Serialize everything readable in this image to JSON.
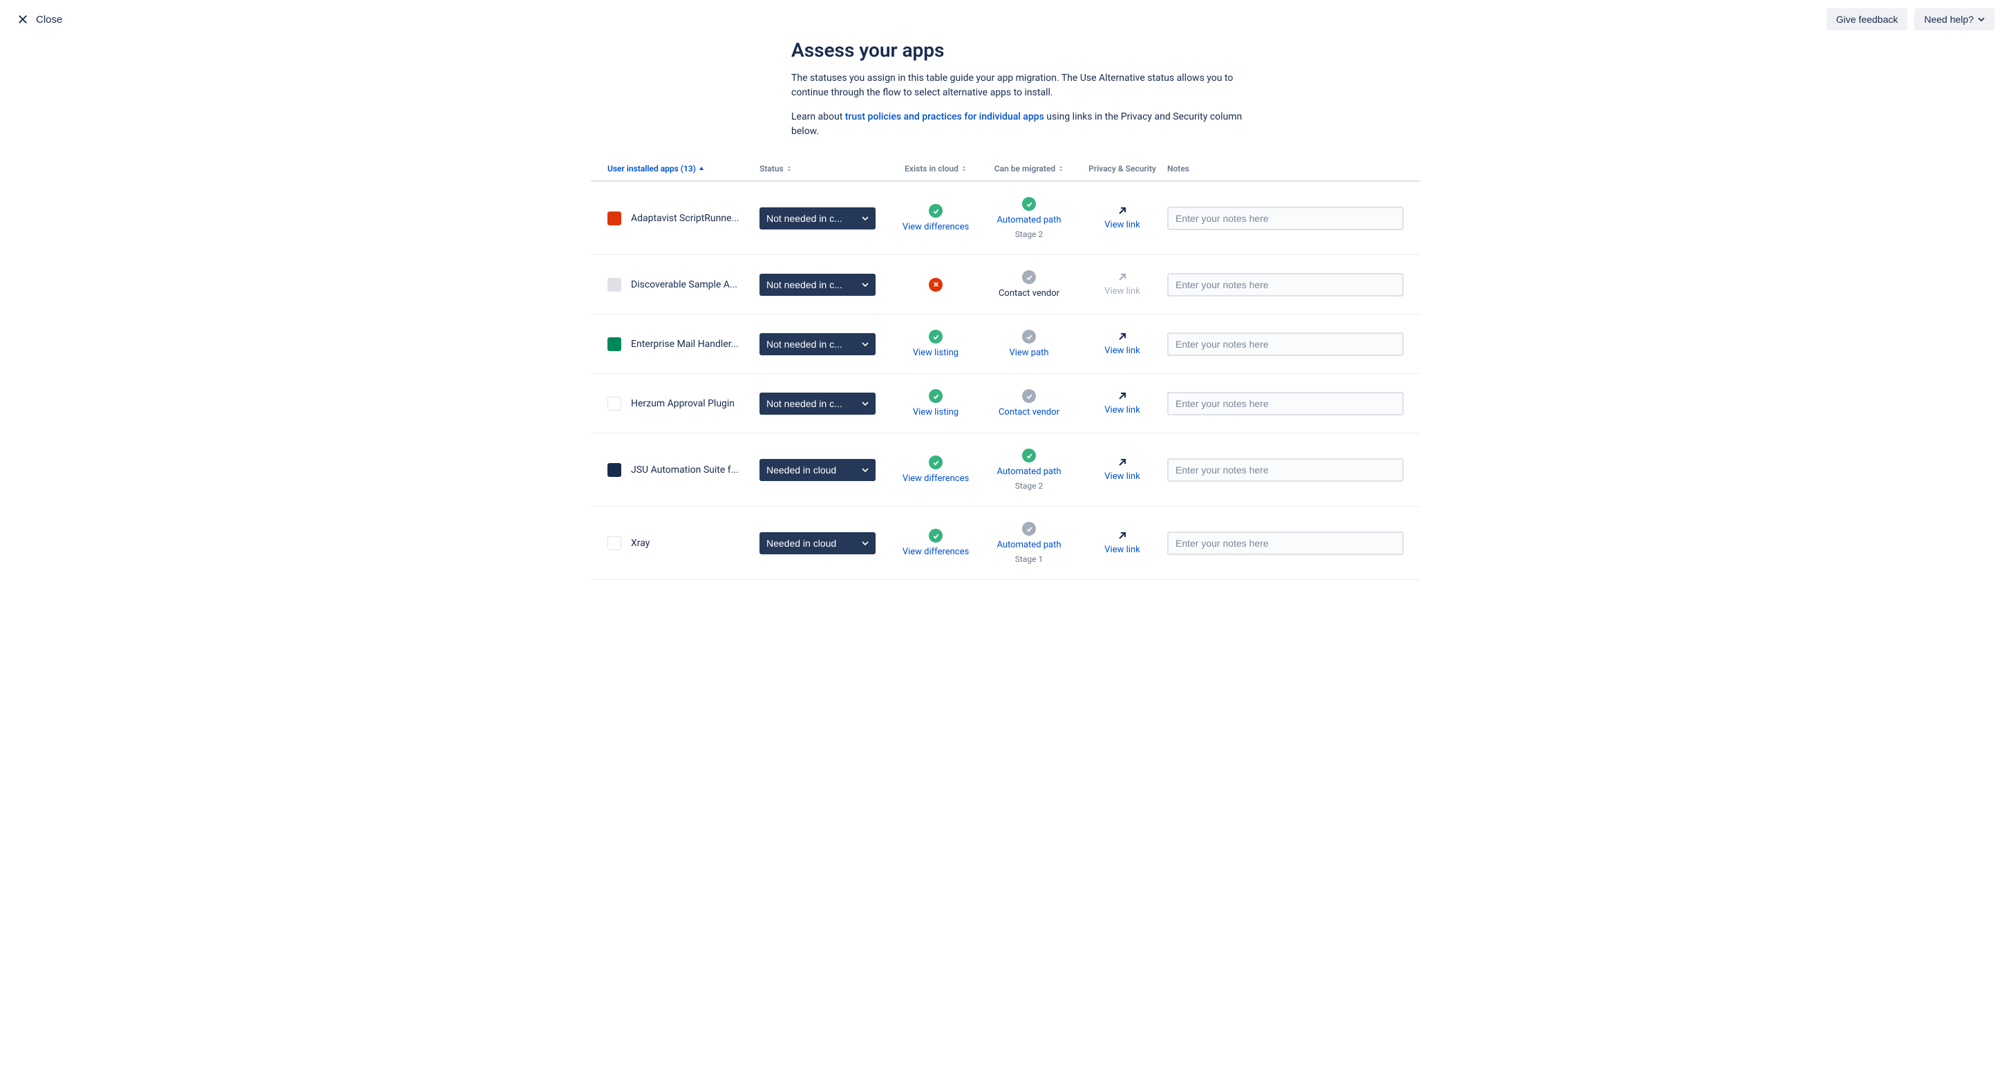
{
  "top": {
    "close": "Close",
    "feedback": "Give feedback",
    "help": "Need help?"
  },
  "header": {
    "title": "Assess your apps",
    "desc": "The statuses you assign in this table guide your app migration. The Use Alternative status allows you to continue through the flow to select alternative apps to install.",
    "learn_pre": "Learn about ",
    "learn_link": "trust policies and practices for individual apps",
    "learn_post": " using links in the Privacy and Security column below."
  },
  "columns": {
    "apps": "User installed apps (13)",
    "status": "Status",
    "exists": "Exists in cloud",
    "migrated": "Can be migrated",
    "privacy": "Privacy & Security",
    "notes": "Notes"
  },
  "notes_placeholder": "Enter your notes here",
  "status_labels": {
    "not_needed": "Not needed in c...",
    "needed": "Needed in cloud"
  },
  "cell_labels": {
    "view_differences": "View differences",
    "view_listing": "View listing",
    "automated_path": "Automated path",
    "view_path": "View path",
    "contact_vendor": "Contact vendor",
    "view_link": "View link",
    "stage1": "Stage 1",
    "stage2": "Stage 2"
  },
  "apps": [
    {
      "name": "Adaptavist ScriptRunne...",
      "icon_bg": "#DE350B",
      "status": "not_needed",
      "exists": {
        "badge": "green",
        "link": "view_differences"
      },
      "migrated": {
        "badge": "green",
        "link": "automated_path",
        "sub": "stage2"
      },
      "privacy": {
        "active": true
      }
    },
    {
      "name": "Discoverable Sample A...",
      "icon_bg": "#DFE1E6",
      "status": "not_needed",
      "exists": {
        "badge": "red"
      },
      "migrated": {
        "badge": "gray",
        "text": "contact_vendor"
      },
      "privacy": {
        "active": false
      }
    },
    {
      "name": "Enterprise Mail Handler...",
      "icon_bg": "#00875A",
      "status": "not_needed",
      "exists": {
        "badge": "green",
        "link": "view_listing"
      },
      "migrated": {
        "badge": "gray",
        "link": "view_path"
      },
      "privacy": {
        "active": true
      }
    },
    {
      "name": "Herzum Approval Plugin",
      "icon_bg": "#FFFFFF",
      "status": "not_needed",
      "exists": {
        "badge": "green",
        "link": "view_listing"
      },
      "migrated": {
        "badge": "gray",
        "link": "contact_vendor"
      },
      "privacy": {
        "active": true
      }
    },
    {
      "name": "JSU Automation Suite f...",
      "icon_bg": "#172B4D",
      "status": "needed",
      "exists": {
        "badge": "green",
        "link": "view_differences"
      },
      "migrated": {
        "badge": "green",
        "link": "automated_path",
        "sub": "stage2"
      },
      "privacy": {
        "active": true
      }
    },
    {
      "name": "Xray",
      "icon_bg": "#FFFFFF",
      "status": "needed",
      "exists": {
        "badge": "green",
        "link": "view_differences"
      },
      "migrated": {
        "badge": "gray",
        "link": "automated_path",
        "sub": "stage1"
      },
      "privacy": {
        "active": true
      }
    }
  ]
}
